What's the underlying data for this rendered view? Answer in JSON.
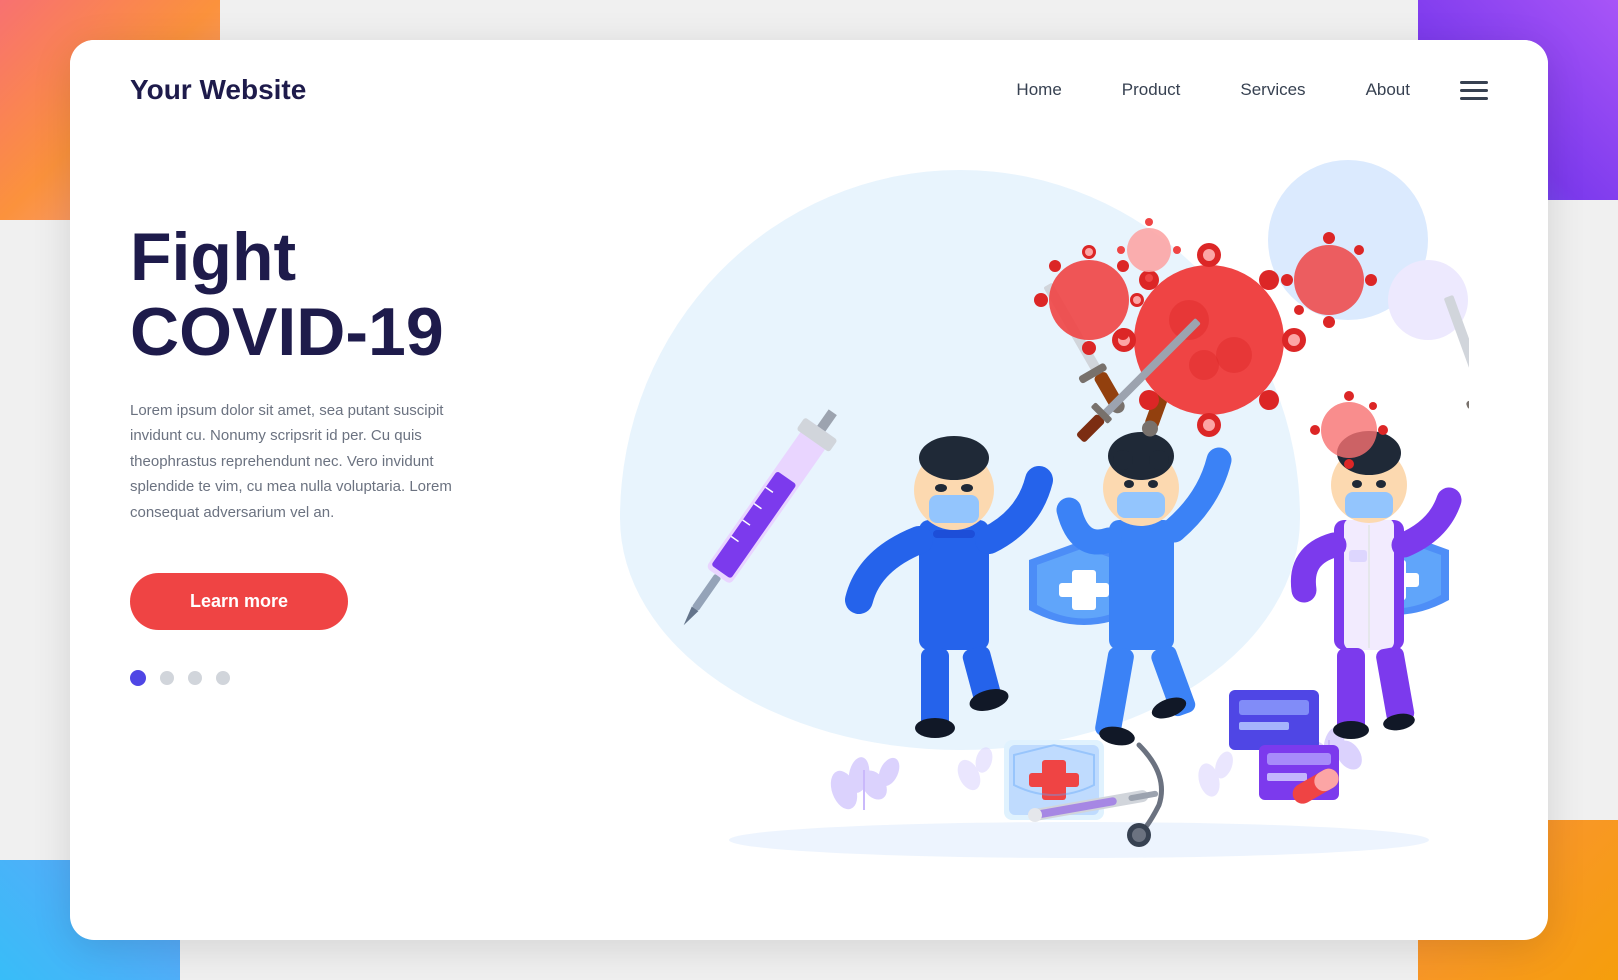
{
  "background": {
    "colors": {
      "topLeft": "#f87171",
      "topRight": "#7c3aed",
      "bottomLeft": "#38bdf8",
      "bottomRight": "#f59e0b"
    }
  },
  "navbar": {
    "logo": "Your Website",
    "links": [
      {
        "label": "Home",
        "id": "home"
      },
      {
        "label": "Product",
        "id": "product"
      },
      {
        "label": "Services",
        "id": "services"
      },
      {
        "label": "About",
        "id": "about"
      }
    ],
    "hamburger_aria": "menu"
  },
  "hero": {
    "title_line1": "Fight",
    "title_line2": "COVID-19",
    "description": "Lorem ipsum dolor sit amet, sea putant suscipit invidunt cu. Nonumy scripsrit id per. Cu quis theophrastus reprehendunt nec. Vero invidunt splendide te vim, cu mea nulla voluptaria. Lorem consequat adversarium vel an.",
    "cta_label": "Learn more",
    "dots": [
      {
        "active": true
      },
      {
        "active": false
      },
      {
        "active": false
      },
      {
        "active": false
      }
    ]
  }
}
